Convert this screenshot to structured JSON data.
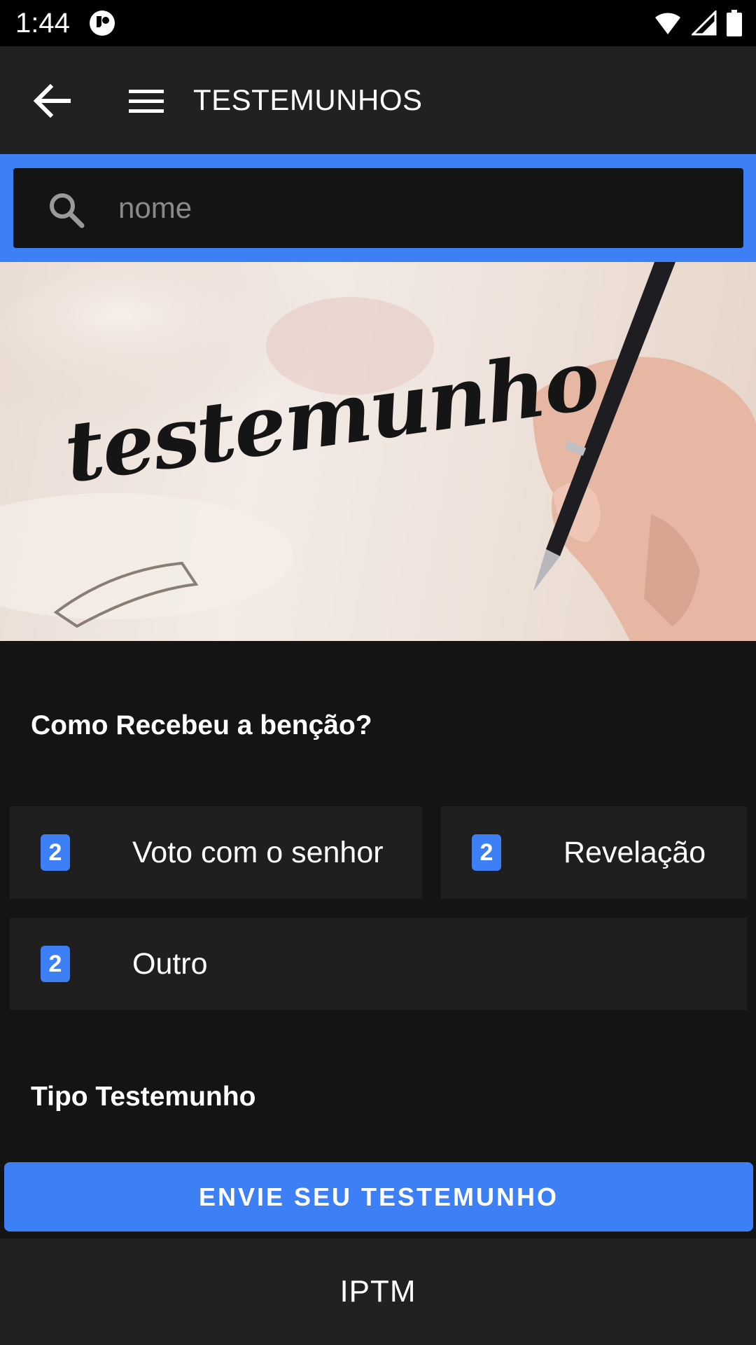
{
  "status_bar": {
    "time": "1:44",
    "icons": [
      "app-notification-icon",
      "wifi-icon",
      "signal-icon",
      "battery-icon"
    ]
  },
  "toolbar": {
    "title": "TESTEMUNHOS",
    "back_icon": "back-arrow-icon",
    "menu_icon": "hamburger-menu-icon"
  },
  "search": {
    "placeholder": "nome",
    "value": "",
    "icon": "search-icon"
  },
  "banner": {
    "text": "testemunho"
  },
  "section_blessing": {
    "title": "Como Recebeu a benção?",
    "options": [
      {
        "count": "2",
        "label": "Voto com o senhor"
      },
      {
        "count": "2",
        "label": "Revelação"
      },
      {
        "count": "2",
        "label": "Outro"
      }
    ]
  },
  "section_type": {
    "title": "Tipo Testemunho"
  },
  "action": {
    "label": "ENVIE SEU TESTEMUNHO"
  },
  "footer": {
    "text": "IPTM"
  },
  "colors": {
    "accent": "#3d7ff5",
    "background": "#141414",
    "surface": "#1f1f1f",
    "toolbar": "#212121"
  }
}
